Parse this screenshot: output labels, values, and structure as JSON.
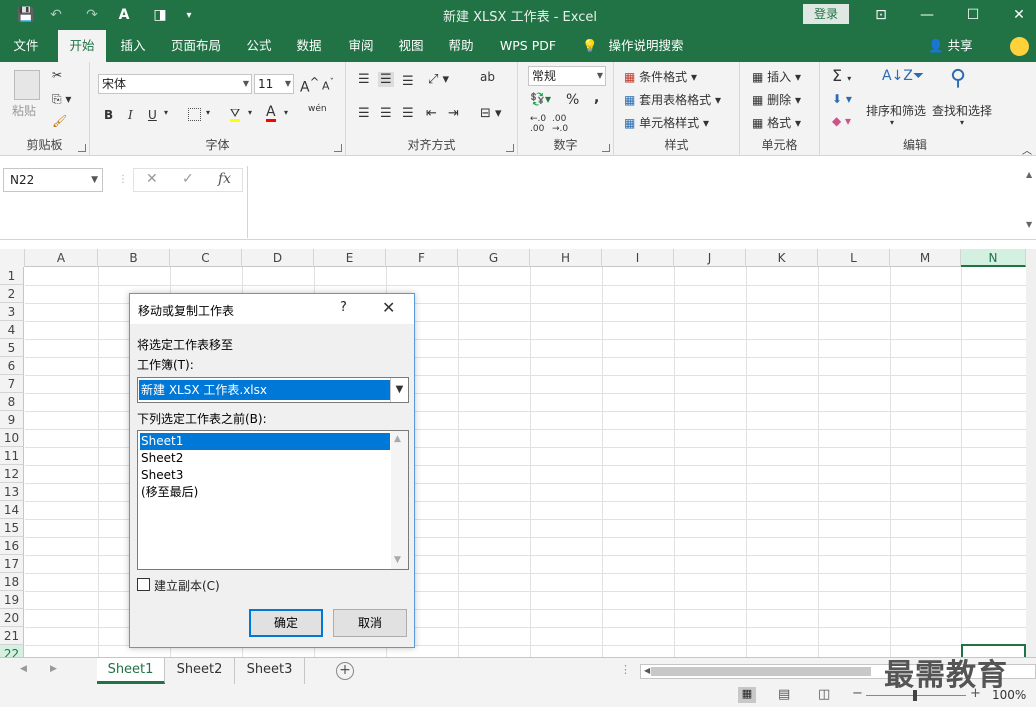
{
  "window": {
    "title": "新建 XLSX 工作表  -  Excel",
    "login_label": "登录",
    "minimize": "—",
    "maximize": "☐",
    "close": "✕",
    "restore_ribbon": "⊡"
  },
  "quick_access": {
    "save": "💾",
    "undo": "↶",
    "redo": "↷",
    "font_color": "A",
    "sheet": "◨",
    "more": "▾"
  },
  "tabs": [
    {
      "label": "文件"
    },
    {
      "label": "开始"
    },
    {
      "label": "插入"
    },
    {
      "label": "页面布局"
    },
    {
      "label": "公式"
    },
    {
      "label": "数据"
    },
    {
      "label": "审阅"
    },
    {
      "label": "视图"
    },
    {
      "label": "帮助"
    },
    {
      "label": "WPS PDF"
    },
    {
      "label": "操作说明搜索"
    }
  ],
  "share_label": "共享",
  "ribbon": {
    "clipboard": {
      "label": "剪贴板",
      "paste": "粘贴"
    },
    "font": {
      "label": "字体",
      "font_name": "宋体",
      "font_size": "11",
      "bold": "B",
      "italic": "I",
      "underline": "U",
      "wen": "wén",
      "a_big": "A",
      "a_small": "A",
      "font_color": "A"
    },
    "alignment": {
      "label": "对齐方式",
      "wrap": "ab"
    },
    "number": {
      "label": "数字",
      "format": "常规",
      "percent": "%",
      "comma": ","
    },
    "styles": {
      "label": "样式",
      "conditional": "条件格式",
      "table": "套用表格格式",
      "cell_styles": "单元格样式"
    },
    "cells": {
      "label": "单元格",
      "insert": "插入",
      "delete": "删除",
      "format": "格式"
    },
    "editing": {
      "label": "编辑",
      "sort": "排序和筛选",
      "find": "查找和选择",
      "sigma": "Σ"
    }
  },
  "formula_bar": {
    "name_box": "N22",
    "cancel": "✕",
    "enter": "✓",
    "fx": "fx"
  },
  "columns": [
    "A",
    "B",
    "C",
    "D",
    "E",
    "F",
    "G",
    "H",
    "I",
    "J",
    "K",
    "L",
    "M",
    "N"
  ],
  "rows": [
    "1",
    "2",
    "3",
    "4",
    "5",
    "6",
    "7",
    "8",
    "9",
    "10",
    "11",
    "12",
    "13",
    "14",
    "15",
    "16",
    "17",
    "18",
    "19",
    "20",
    "21",
    "22"
  ],
  "sheets": [
    {
      "label": "Sheet1"
    },
    {
      "label": "Sheet2"
    },
    {
      "label": "Sheet3"
    }
  ],
  "add_sheet": "+",
  "status": {
    "zoom": "100%"
  },
  "watermark": "最需教育",
  "dialog": {
    "title": "移动或复制工作表",
    "help": "?",
    "close": "✕",
    "move_to_label": "将选定工作表移至",
    "workbook_label": "工作簿(T):",
    "workbook_value": "新建 XLSX 工作表.xlsx",
    "before_label": "下列选定工作表之前(B):",
    "list": [
      "Sheet1",
      "Sheet2",
      "Sheet3",
      "(移至最后)"
    ],
    "copy_label": "建立副本(C)",
    "ok": "确定",
    "cancel": "取消"
  }
}
